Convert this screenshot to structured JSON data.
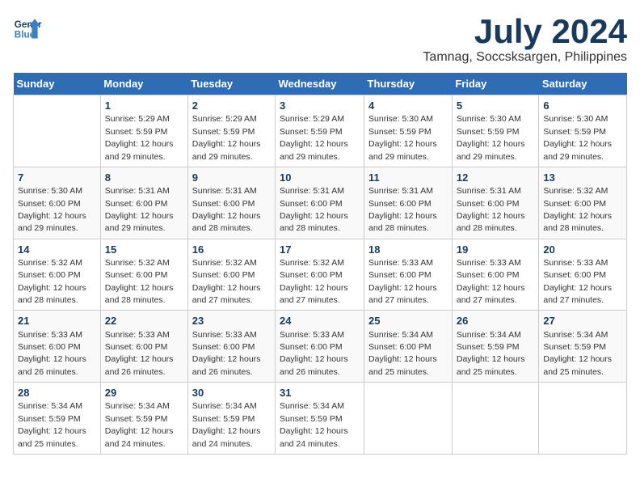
{
  "header": {
    "logo_general": "General",
    "logo_blue": "Blue",
    "month_title": "July 2024",
    "location": "Tamnag, Soccsksargen, Philippines"
  },
  "days_of_week": [
    "Sunday",
    "Monday",
    "Tuesday",
    "Wednesday",
    "Thursday",
    "Friday",
    "Saturday"
  ],
  "weeks": [
    [
      {
        "day": "",
        "info": ""
      },
      {
        "day": "1",
        "info": "Sunrise: 5:29 AM\nSunset: 5:59 PM\nDaylight: 12 hours\nand 29 minutes."
      },
      {
        "day": "2",
        "info": "Sunrise: 5:29 AM\nSunset: 5:59 PM\nDaylight: 12 hours\nand 29 minutes."
      },
      {
        "day": "3",
        "info": "Sunrise: 5:29 AM\nSunset: 5:59 PM\nDaylight: 12 hours\nand 29 minutes."
      },
      {
        "day": "4",
        "info": "Sunrise: 5:30 AM\nSunset: 5:59 PM\nDaylight: 12 hours\nand 29 minutes."
      },
      {
        "day": "5",
        "info": "Sunrise: 5:30 AM\nSunset: 5:59 PM\nDaylight: 12 hours\nand 29 minutes."
      },
      {
        "day": "6",
        "info": "Sunrise: 5:30 AM\nSunset: 5:59 PM\nDaylight: 12 hours\nand 29 minutes."
      }
    ],
    [
      {
        "day": "7",
        "info": "Sunrise: 5:30 AM\nSunset: 6:00 PM\nDaylight: 12 hours\nand 29 minutes."
      },
      {
        "day": "8",
        "info": "Sunrise: 5:31 AM\nSunset: 6:00 PM\nDaylight: 12 hours\nand 29 minutes."
      },
      {
        "day": "9",
        "info": "Sunrise: 5:31 AM\nSunset: 6:00 PM\nDaylight: 12 hours\nand 28 minutes."
      },
      {
        "day": "10",
        "info": "Sunrise: 5:31 AM\nSunset: 6:00 PM\nDaylight: 12 hours\nand 28 minutes."
      },
      {
        "day": "11",
        "info": "Sunrise: 5:31 AM\nSunset: 6:00 PM\nDaylight: 12 hours\nand 28 minutes."
      },
      {
        "day": "12",
        "info": "Sunrise: 5:31 AM\nSunset: 6:00 PM\nDaylight: 12 hours\nand 28 minutes."
      },
      {
        "day": "13",
        "info": "Sunrise: 5:32 AM\nSunset: 6:00 PM\nDaylight: 12 hours\nand 28 minutes."
      }
    ],
    [
      {
        "day": "14",
        "info": "Sunrise: 5:32 AM\nSunset: 6:00 PM\nDaylight: 12 hours\nand 28 minutes."
      },
      {
        "day": "15",
        "info": "Sunrise: 5:32 AM\nSunset: 6:00 PM\nDaylight: 12 hours\nand 28 minutes."
      },
      {
        "day": "16",
        "info": "Sunrise: 5:32 AM\nSunset: 6:00 PM\nDaylight: 12 hours\nand 27 minutes."
      },
      {
        "day": "17",
        "info": "Sunrise: 5:32 AM\nSunset: 6:00 PM\nDaylight: 12 hours\nand 27 minutes."
      },
      {
        "day": "18",
        "info": "Sunrise: 5:33 AM\nSunset: 6:00 PM\nDaylight: 12 hours\nand 27 minutes."
      },
      {
        "day": "19",
        "info": "Sunrise: 5:33 AM\nSunset: 6:00 PM\nDaylight: 12 hours\nand 27 minutes."
      },
      {
        "day": "20",
        "info": "Sunrise: 5:33 AM\nSunset: 6:00 PM\nDaylight: 12 hours\nand 27 minutes."
      }
    ],
    [
      {
        "day": "21",
        "info": "Sunrise: 5:33 AM\nSunset: 6:00 PM\nDaylight: 12 hours\nand 26 minutes."
      },
      {
        "day": "22",
        "info": "Sunrise: 5:33 AM\nSunset: 6:00 PM\nDaylight: 12 hours\nand 26 minutes."
      },
      {
        "day": "23",
        "info": "Sunrise: 5:33 AM\nSunset: 6:00 PM\nDaylight: 12 hours\nand 26 minutes."
      },
      {
        "day": "24",
        "info": "Sunrise: 5:33 AM\nSunset: 6:00 PM\nDaylight: 12 hours\nand 26 minutes."
      },
      {
        "day": "25",
        "info": "Sunrise: 5:34 AM\nSunset: 6:00 PM\nDaylight: 12 hours\nand 25 minutes."
      },
      {
        "day": "26",
        "info": "Sunrise: 5:34 AM\nSunset: 5:59 PM\nDaylight: 12 hours\nand 25 minutes."
      },
      {
        "day": "27",
        "info": "Sunrise: 5:34 AM\nSunset: 5:59 PM\nDaylight: 12 hours\nand 25 minutes."
      }
    ],
    [
      {
        "day": "28",
        "info": "Sunrise: 5:34 AM\nSunset: 5:59 PM\nDaylight: 12 hours\nand 25 minutes."
      },
      {
        "day": "29",
        "info": "Sunrise: 5:34 AM\nSunset: 5:59 PM\nDaylight: 12 hours\nand 24 minutes."
      },
      {
        "day": "30",
        "info": "Sunrise: 5:34 AM\nSunset: 5:59 PM\nDaylight: 12 hours\nand 24 minutes."
      },
      {
        "day": "31",
        "info": "Sunrise: 5:34 AM\nSunset: 5:59 PM\nDaylight: 12 hours\nand 24 minutes."
      },
      {
        "day": "",
        "info": ""
      },
      {
        "day": "",
        "info": ""
      },
      {
        "day": "",
        "info": ""
      }
    ]
  ]
}
